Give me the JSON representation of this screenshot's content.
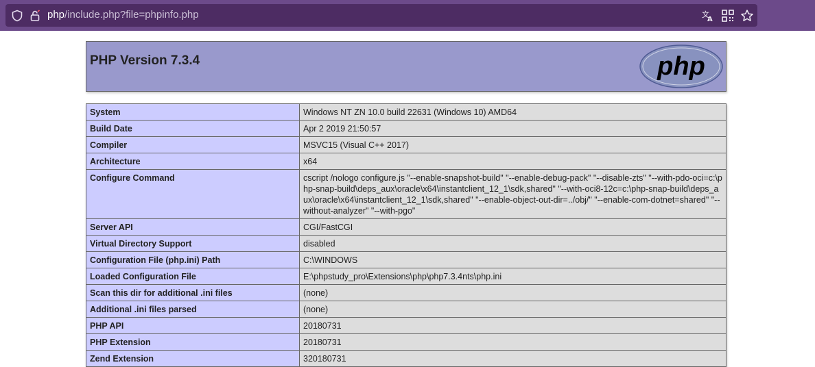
{
  "browser": {
    "url_host": "php",
    "url_path": "/include.php?file=phpinfo.php",
    "icons": [
      "shield-icon",
      "permissions-icon",
      "translate-icon",
      "qr-code-icon",
      "bookmark-star-icon"
    ]
  },
  "page": {
    "title": "PHP Version 7.3.4",
    "logo_text": "php",
    "rows": [
      {
        "key": "System",
        "value": "Windows NT ZN 10.0 build 22631 (Windows 10) AMD64"
      },
      {
        "key": "Build Date",
        "value": "Apr 2 2019 21:50:57"
      },
      {
        "key": "Compiler",
        "value": "MSVC15 (Visual C++ 2017)"
      },
      {
        "key": "Architecture",
        "value": "x64"
      },
      {
        "key": "Configure Command",
        "value": "cscript /nologo configure.js \"--enable-snapshot-build\" \"--enable-debug-pack\" \"--disable-zts\" \"--with-pdo-oci=c:\\php-snap-build\\deps_aux\\oracle\\x64\\instantclient_12_1\\sdk,shared\" \"--with-oci8-12c=c:\\php-snap-build\\deps_aux\\oracle\\x64\\instantclient_12_1\\sdk,shared\" \"--enable-object-out-dir=../obj/\" \"--enable-com-dotnet=shared\" \"--without-analyzer\" \"--with-pgo\""
      },
      {
        "key": "Server API",
        "value": "CGI/FastCGI"
      },
      {
        "key": "Virtual Directory Support",
        "value": "disabled"
      },
      {
        "key": "Configuration File (php.ini) Path",
        "value": "C:\\WINDOWS"
      },
      {
        "key": "Loaded Configuration File",
        "value": "E:\\phpstudy_pro\\Extensions\\php\\php7.3.4nts\\php.ini"
      },
      {
        "key": "Scan this dir for additional .ini files",
        "value": "(none)"
      },
      {
        "key": "Additional .ini files parsed",
        "value": "(none)"
      },
      {
        "key": "PHP API",
        "value": "20180731"
      },
      {
        "key": "PHP Extension",
        "value": "20180731"
      },
      {
        "key": "Zend Extension",
        "value": "320180731"
      }
    ]
  },
  "colors": {
    "chrome": "#6c4a8a",
    "urlbar": "#4d2c63",
    "header_bg": "#9999cc",
    "key_bg": "#ccccff",
    "value_bg": "#dddddd"
  }
}
